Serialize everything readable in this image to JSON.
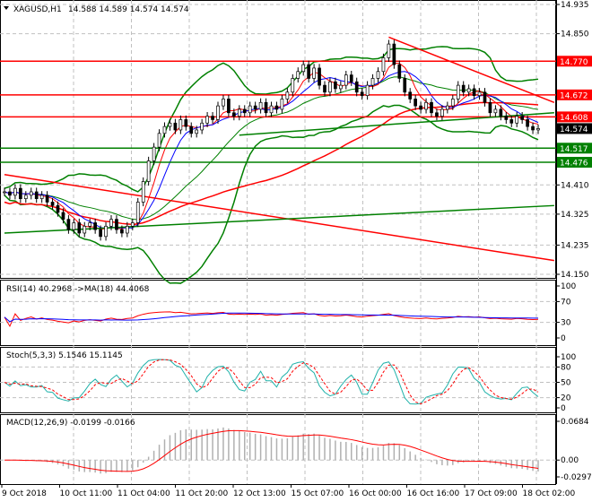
{
  "header": {
    "symbol": "XAGUSD,H1",
    "ohlc": "14.588 14.589 14.574 14.574"
  },
  "chart_data": [
    {
      "type": "candlestick",
      "title": "XAGUSD,H1",
      "ylim": [
        14.15,
        14.935
      ],
      "y_ticks": [
        "14.935",
        "14.850",
        "14.770",
        "14.672",
        "14.608",
        "14.574",
        "14.517",
        "14.476",
        "14.410",
        "14.325",
        "14.235",
        "14.150"
      ],
      "closes": [
        14.39,
        14.38,
        14.4,
        14.37,
        14.38,
        14.39,
        14.37,
        14.38,
        14.36,
        14.35,
        14.33,
        14.31,
        14.28,
        14.3,
        14.27,
        14.29,
        14.3,
        14.28,
        14.26,
        14.29,
        14.31,
        14.28,
        14.27,
        14.29,
        14.3,
        14.36,
        14.42,
        14.48,
        14.52,
        14.56,
        14.58,
        14.59,
        14.57,
        14.6,
        14.58,
        14.56,
        14.57,
        14.59,
        14.61,
        14.6,
        14.64,
        14.66,
        14.62,
        14.61,
        14.63,
        14.62,
        14.64,
        14.63,
        14.65,
        14.62,
        14.64,
        14.63,
        14.66,
        14.68,
        14.72,
        14.74,
        14.76,
        14.72,
        14.75,
        14.7,
        14.68,
        14.71,
        14.69,
        14.7,
        14.73,
        14.71,
        14.68,
        14.67,
        14.7,
        14.72,
        14.74,
        14.78,
        14.82,
        14.76,
        14.72,
        14.68,
        14.66,
        14.64,
        14.63,
        14.65,
        14.62,
        14.61,
        14.63,
        14.64,
        14.66,
        14.7,
        14.68,
        14.69,
        14.67,
        14.68,
        14.65,
        14.62,
        14.63,
        14.61,
        14.6,
        14.59,
        14.61,
        14.6,
        14.58,
        14.57,
        14.574
      ],
      "levels": [
        {
          "price": 14.77,
          "label": "14.770",
          "color": "#ff0000"
        },
        {
          "price": 14.672,
          "label": "14.672",
          "color": "#ff0000"
        },
        {
          "price": 14.608,
          "label": "14.608",
          "color": "#ff0000"
        },
        {
          "price": 14.517,
          "label": "14.517",
          "color": "#008000"
        },
        {
          "price": 14.476,
          "label": "14.476",
          "color": "#008000"
        }
      ],
      "current_price": {
        "price": 14.574,
        "label": "14.574",
        "color": "#000000"
      },
      "trendlines": [
        {
          "from": [
            72,
            14.84
          ],
          "to": [
            103,
            14.65
          ],
          "color": "#ff0000"
        },
        {
          "from": [
            0,
            14.44
          ],
          "to": [
            103,
            14.19
          ],
          "color": "#ff0000"
        },
        {
          "from": [
            0,
            14.27
          ],
          "to": [
            103,
            14.35
          ],
          "color": "#008000"
        },
        {
          "from": [
            44,
            14.555
          ],
          "to": [
            103,
            14.62
          ],
          "color": "#008000"
        }
      ]
    },
    {
      "type": "line",
      "title": "RSI(14) 40.2968  ->MA(18) 44.4068",
      "ylim": [
        0,
        100
      ],
      "y_ticks": [
        "100",
        "70",
        "30",
        "0"
      ]
    },
    {
      "type": "line",
      "title": "Stoch(5,3,3) 5.1546 15.1145",
      "ylim": [
        0,
        100
      ],
      "y_ticks": [
        "100",
        "80",
        "50",
        "20",
        "0"
      ]
    },
    {
      "type": "bar",
      "title": "MACD(12,26,9) -0.0199 -0.0166",
      "ylim": [
        -0.0297,
        0.0684
      ],
      "y_ticks": [
        "0.0684",
        "0.00",
        "-0.0297"
      ]
    }
  ],
  "x_labels": [
    "9 Oct 2018",
    "10 Oct 11:00",
    "11 Oct 04:00",
    "11 Oct 20:00",
    "12 Oct 13:00",
    "15 Oct 07:00",
    "16 Oct 00:00",
    "16 Oct 16:00",
    "17 Oct 09:00",
    "18 Oct 02:00"
  ]
}
